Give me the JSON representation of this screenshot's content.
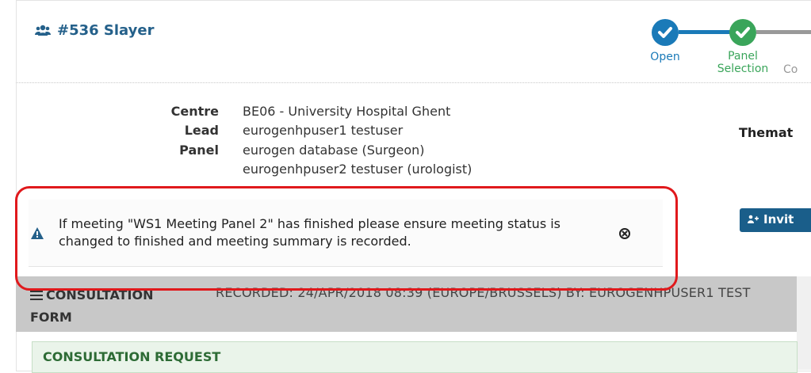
{
  "case": {
    "title": "#536 Slayer",
    "icon": "users-icon"
  },
  "workflow": {
    "steps": [
      {
        "label": "Open",
        "status": "done",
        "color": "#1a7ab8"
      },
      {
        "label": "Panel\nSelection",
        "status": "done",
        "color": "#3aa55a"
      },
      {
        "label": "Co",
        "status": "pending",
        "color": "#999999"
      }
    ]
  },
  "details": {
    "centre_label": "Centre",
    "centre_value": "BE06 - University Hospital Ghent",
    "lead_label": "Lead",
    "lead_value": "eurogenhpuser1 testuser",
    "panel_label": "Panel",
    "panel_values": [
      "eurogen database (Surgeon)",
      "eurogenhpuser2 testuser (urologist)"
    ],
    "thematic_label": "Themat"
  },
  "alert": {
    "text": "If meeting \"WS1 Meeting Panel 2\" has finished please ensure meeting status is changed to finished and meeting summary is recorded.",
    "highlight_color": "#e0191c"
  },
  "invite_button": {
    "label": "Invit"
  },
  "consultation": {
    "title_line1": "CONSULTATION",
    "title_line2": "FORM",
    "recorded": "RECORDED: 24/APR/2018 08:39 (EUROPE/BRUSSELS) BY: EUROGENHPUSER1 TEST"
  },
  "request": {
    "title": "CONSULTATION REQUEST"
  },
  "colors": {
    "brand": "#24608a",
    "accent_green": "#3aa55a",
    "accent_blue": "#1a7ab8"
  }
}
